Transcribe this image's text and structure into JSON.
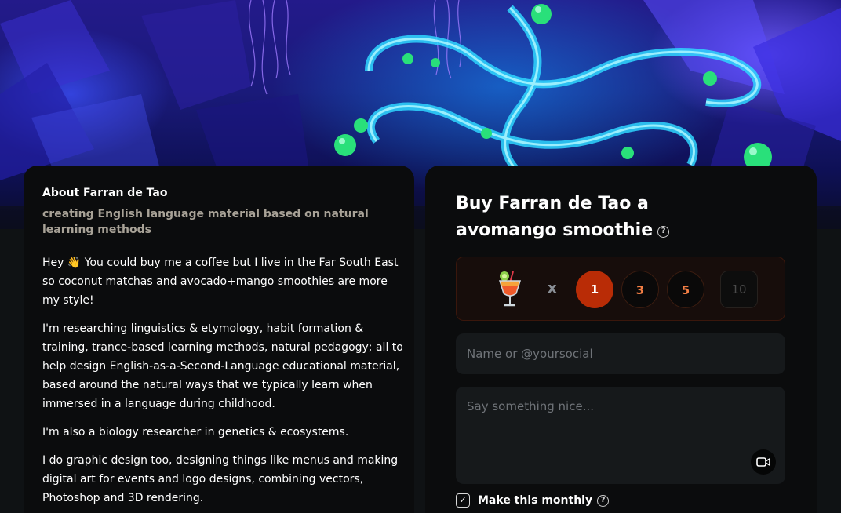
{
  "about": {
    "title": "About Farran de Tao",
    "subtitle": "creating English language material based on natural learning methods",
    "paragraphs": [
      "Hey 👋 You could buy me a coffee but I live in the Far South East so coconut matchas and avocado+mango smoothies are more my style!",
      "I'm researching linguistics & etymology, habit formation & training, trance-based learning methods, natural pedagogy; all to help design English-as-a-Second-Language educational material, based around the natural ways that we typically learn when immersed in a language during childhood.",
      "I'm also a biology researcher in genetics & ecosystems.",
      "I do graphic design too, designing things like menus and making digital art for events and logo designs, combining vectors, Photoshop and 3D rendering."
    ]
  },
  "buy": {
    "title": "Buy Farran de Tao a avomango smoothie",
    "help_icon": "question-circle-icon",
    "item_icon": "tropical-drink-icon",
    "times_symbol": "x",
    "quantities": [
      "1",
      "3",
      "5"
    ],
    "selected_quantity": "1",
    "custom_quantity_placeholder": "10",
    "name_placeholder": "Name or @yoursocial",
    "message_placeholder": "Say something nice...",
    "video_icon": "video-camera-icon",
    "monthly_label": "Make this monthly",
    "monthly_checked": true,
    "check_mark": "✓"
  },
  "colors": {
    "accent": "#b92c06",
    "accent_text": "#f47f45",
    "card_bg": "#0b0c0d",
    "subtitle": "#a8a297"
  }
}
